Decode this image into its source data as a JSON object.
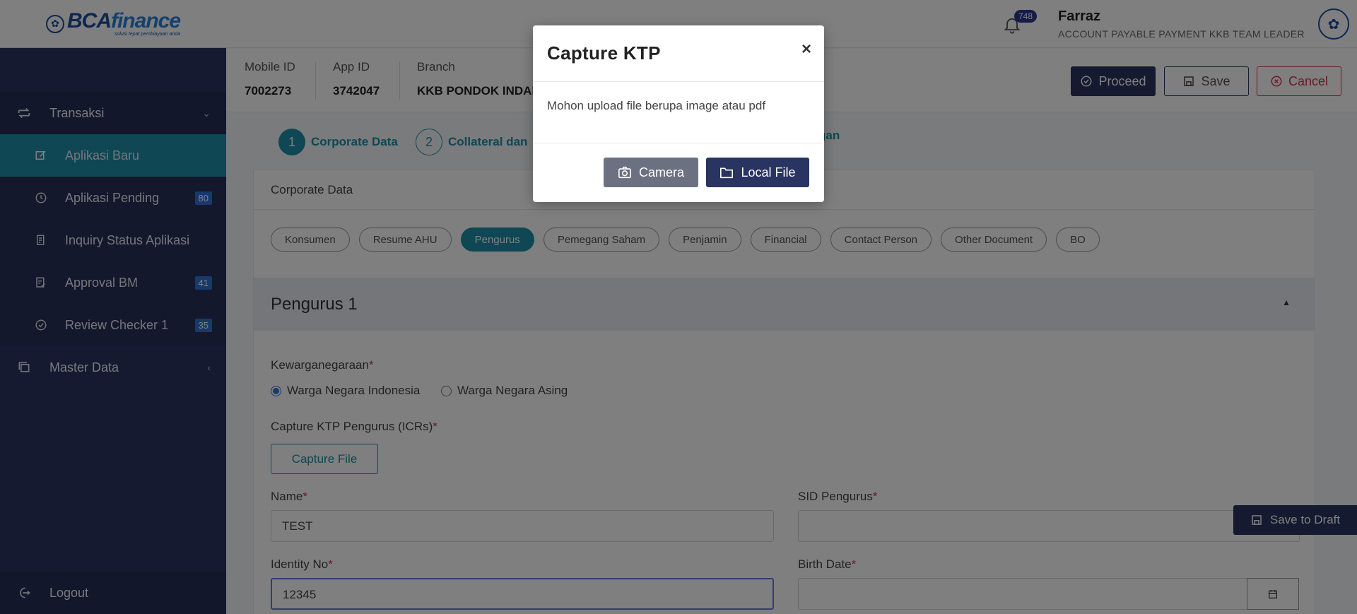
{
  "brand": {
    "logo_main": "BCA",
    "logo_main_2": "finance",
    "logo_tagline": "solusi tepat pembiayaan anda"
  },
  "sidebar": {
    "group_transaksi": "Transaksi",
    "items": [
      {
        "label": "Aplikasi Baru",
        "badge": ""
      },
      {
        "label": "Aplikasi Pending",
        "badge": "80"
      },
      {
        "label": "Inquiry Status Aplikasi",
        "badge": ""
      },
      {
        "label": "Approval BM",
        "badge": "41"
      },
      {
        "label": "Review Checker 1",
        "badge": "35"
      }
    ],
    "group_master": "Master Data",
    "logout": "Logout"
  },
  "topbar": {
    "notif_count": "748",
    "user_name": "Farraz",
    "user_role": "ACCOUNT PAYABLE PAYMENT KKB TEAM LEADER"
  },
  "info": {
    "mobile_id_label": "Mobile ID",
    "mobile_id_value": "7002273",
    "app_id_label": "App ID",
    "app_id_value": "3742047",
    "branch_label": "Branch",
    "branch_value": "KKB PONDOK INDAH"
  },
  "actions": {
    "proceed": "Proceed",
    "save": "Save",
    "cancel": "Cancel"
  },
  "steps": [
    {
      "num": "1",
      "label": "Corporate Data"
    },
    {
      "num": "2",
      "label": "Collateral dan"
    },
    {
      "label": "gan"
    }
  ],
  "card": {
    "title": "Corporate Data",
    "tabs": [
      "Konsumen",
      "Resume AHU",
      "Pengurus",
      "Pemegang Saham",
      "Penjamin",
      "Financial",
      "Contact Person",
      "Other Document",
      "BO"
    ],
    "active_tab": "Pengurus",
    "section_title": "Pengurus 1"
  },
  "form": {
    "kewarganegaraan_label": "Kewarganegaraan",
    "radio_wni": "Warga Negara Indonesia",
    "radio_wna": "Warga Negara Asing",
    "capture_label": "Capture KTP Pengurus (ICRs)",
    "capture_button": "Capture File",
    "name_label": "Name",
    "name_value": "TEST",
    "sid_label": "SID Pengurus",
    "sid_value": "",
    "identity_label": "Identity No",
    "identity_value": "12345",
    "birth_label": "Birth Date",
    "birth_value": "",
    "required_mark": "*"
  },
  "draft": {
    "label": "Save to Draft"
  },
  "modal": {
    "title": "Capture KTP",
    "close": "×",
    "message": "Mohon upload file berupa image atau pdf",
    "camera": "Camera",
    "local_file": "Local File"
  }
}
